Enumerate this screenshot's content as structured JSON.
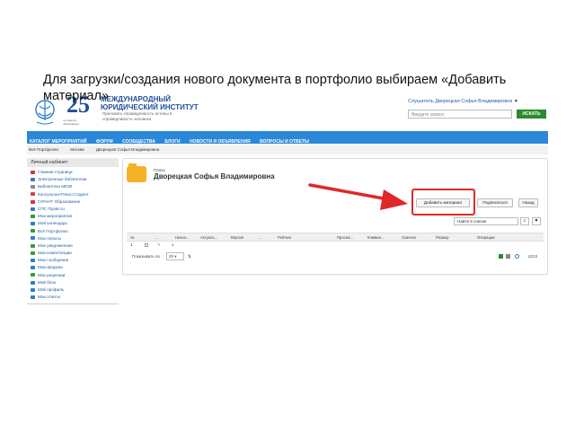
{
  "caption": "Для загрузки/создания нового документа в портфолио выбираем «Добавить материал»",
  "header": {
    "logo_number": "25",
    "logo_slogan": "лет вместе образования",
    "institute_name": "МЕЖДУНАРОДНЫЙ ЮРИДИЧЕСКИЙ ИНСТИТУТ",
    "institute_sub": "Преповать справедливость истины в справедливость человека",
    "user_link": "Слушатель Дворецкая Софья Владимировна",
    "search_placeholder": "Введите запрос",
    "search_button": "ИСКАТЬ"
  },
  "nav": {
    "items": [
      "КАТАЛОГ МЕРОПРИЯТИЙ",
      "ФОРУМ",
      "СООБЩЕСТВА",
      "БЛОГИ",
      "НОВОСТИ И ОБЪЯВЛЕНИЯ",
      "ВОПРОСЫ И ОТВЕТЫ"
    ]
  },
  "breadcrumb": [
    "Всё Портфолио",
    "Москва",
    "Дворецкая Софья Владимировна"
  ],
  "sidebar": {
    "title": "Личный кабинет",
    "items": [
      {
        "label": "Главная страница",
        "color": "#d33"
      },
      {
        "label": "Электронные библиотеки",
        "color": "#2a7dd0"
      },
      {
        "label": "Библиотека МЮИ",
        "color": "#888"
      },
      {
        "label": "КонсультантПлюс:Студент",
        "color": "#c44"
      },
      {
        "label": "ГАРАНТ-Образование",
        "color": "#d33"
      },
      {
        "label": "СПС Право.ru",
        "color": "#2a7dd0"
      },
      {
        "label": "Мои мероприятия",
        "color": "#3a9a3a"
      },
      {
        "label": "Мой календарь",
        "color": "#2a7dd0"
      },
      {
        "label": "Всё Портфолио",
        "color": "#3a9a3a"
      },
      {
        "label": "Мои опросы",
        "color": "#2a7dd0"
      },
      {
        "label": "Мои уведомления",
        "color": "#3a9a3a"
      },
      {
        "label": "Мои компетенции",
        "color": "#3a9a3a"
      },
      {
        "label": "Мои сообщения",
        "color": "#2a7dd0"
      },
      {
        "label": "Мои форумы",
        "color": "#2a7dd0"
      },
      {
        "label": "Мои рецензии",
        "color": "#3a9a3a"
      },
      {
        "label": "Мой блок",
        "color": "#2a7dd0"
      },
      {
        "label": "Мой профиль",
        "color": "#2a7dd0"
      },
      {
        "label": "Мои ответы",
        "color": "#2a7dd0"
      }
    ]
  },
  "panel": {
    "folder_label": "Папка",
    "owner_name": "Дворецкая Софья Владимировна",
    "add_button": "Добавить материал",
    "subscribe_button": "Подписаться",
    "back_button": "Назад",
    "find_placeholder": "Найти в списке",
    "columns": [
      "№",
      "",
      "...",
      "Назна...",
      "Актуаль...",
      "Версия",
      "...",
      "Рейтинг",
      "Просмо...",
      "Коммен...",
      "Скачано",
      "Размер",
      "Операции"
    ],
    "row": [
      "1",
      "",
      "",
      "a"
    ],
    "per_page_label": "Показывать по",
    "per_page_value": "20",
    "count": "12/12"
  }
}
